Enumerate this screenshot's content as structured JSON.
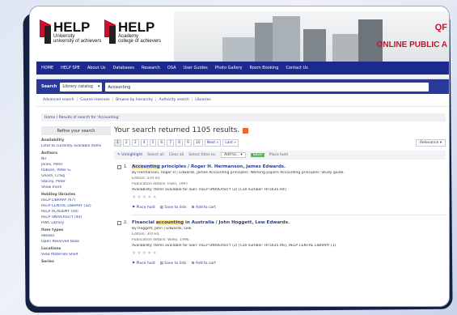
{
  "header": {
    "logo1": {
      "big": "HELP",
      "line1": "University",
      "line2": "university of achievers"
    },
    "logo2": {
      "big": "HELP",
      "line1": "Academy",
      "line2": "college of achievers"
    },
    "tagline1": "QF",
    "tagline2": "ONLINE PUBLIC A"
  },
  "nav": [
    "HOME",
    "HELP SPE",
    "About Us",
    "Databases",
    "Research",
    "OSA",
    "User Guides",
    "Photo Gallery",
    "Room Booking",
    "Contact Us"
  ],
  "search": {
    "label": "Search",
    "scope": "Library catalog",
    "value": "Accounting"
  },
  "links": [
    "Advanced search",
    "Course reserves",
    "Browse by hierarchy",
    "Authority search",
    "Libraries"
  ],
  "breadcrumb": {
    "home": "Home",
    "current": "Results of search for 'Accounting'"
  },
  "sidebar": {
    "refine": "Refine your search",
    "groups": [
      {
        "heading": "Availability",
        "items": [
          "Limit to currently available items"
        ]
      },
      {
        "heading": "Authors",
        "items": [
          "Nil",
          "Jones, Peter",
          "Robson, Peter G.",
          "Ghosh, Craig",
          "Stacey, Peter",
          "Show more"
        ]
      },
      {
        "heading": "Holding libraries",
        "items": [
          "HELP LIBRARY (67)",
          "HELP CENTRE LIBRARY (32)",
          "HELP ACADEMY (44)",
          "HELP UNIVERSITY (40)",
          "HWC Library"
        ]
      },
      {
        "heading": "Item types",
        "items": [
          "eBooks",
          "Open Reserved Book"
        ]
      },
      {
        "heading": "Locations",
        "items": [
          "View Materials Shelf"
        ]
      },
      {
        "heading": "Series",
        "items": []
      }
    ]
  },
  "results": {
    "title": "Your search returned 1105 results.",
    "pages": [
      "1",
      "2",
      "3",
      "4",
      "5",
      "6",
      "7",
      "8",
      "9",
      "10",
      "Next »",
      "Last »"
    ],
    "active_page": "1",
    "sort": "Relevance"
  },
  "toolbar": {
    "unhighlight": "Unhighlight",
    "select_all": "Select all",
    "clear_all": "Clear all",
    "select_titles": "Select titles to:",
    "add_to": "Add to...",
    "save": "Save",
    "place_hold": "Place hold"
  },
  "records": [
    {
      "num": "1.",
      "title_a": "Accounting",
      "title_b": " principles / Roger H. Hermanson, James Edwards.",
      "by": "By Hermanson, Roger H | Edwards, James Accounting principles: Working papers Accounting principles: Study guide.",
      "edition": "Edition: 2nd ed.",
      "pub": "Publication details: Irwin, 1997",
      "avail": "Availability: Items available for loan: HELP UNIVERSITY (2) [Call number: HF5635.H4]",
      "actions": [
        "Place hold",
        "Save to lists",
        "Add to cart"
      ]
    },
    {
      "num": "2.",
      "title_a": "Financial ",
      "title_hl": "accounting",
      "title_b": " in Australia / John Hoggett, Lew Edwards.",
      "by": "By Hoggett, John | Edwards, Lew.",
      "edition": "Edition: 3rd ed.",
      "pub": "Publication details: Wiley, 1996",
      "avail": "Availability: Items available for loan: HELP UNIVERSITY (2) [Call number: HF5635.H6], HELP CENTRE LIBRARY (1)",
      "actions": [
        "Place hold",
        "Save to lists",
        "Add to cart"
      ]
    }
  ]
}
